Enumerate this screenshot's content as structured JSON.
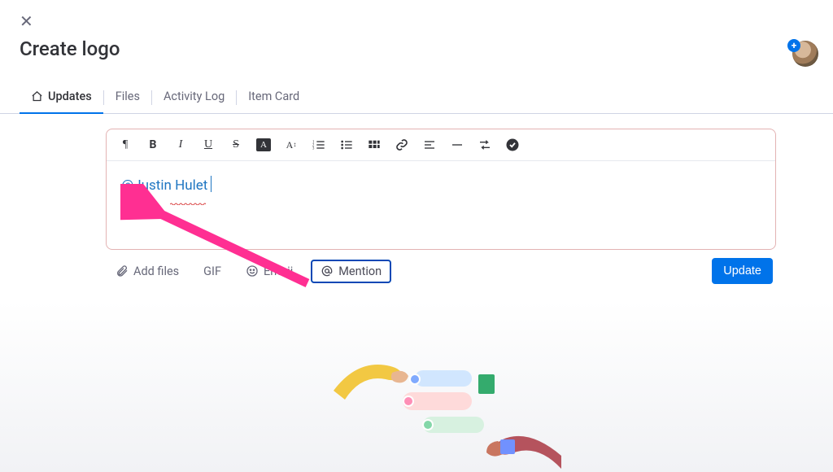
{
  "header": {
    "title": "Create logo"
  },
  "tabs": {
    "updates": "Updates",
    "files": "Files",
    "activity": "Activity Log",
    "item_card": "Item Card"
  },
  "toolbar": {
    "paragraph": "¶",
    "bold": "B",
    "italic": "I",
    "underline": "U",
    "strike": "S",
    "invert": "A",
    "font_size": "A",
    "checklist": "✓"
  },
  "editor": {
    "mention_text": "@Justin Hulet"
  },
  "bottom": {
    "add_files": "Add files",
    "gif": "GIF",
    "emoji": "Emoji",
    "mention": "Mention",
    "update": "Update"
  }
}
